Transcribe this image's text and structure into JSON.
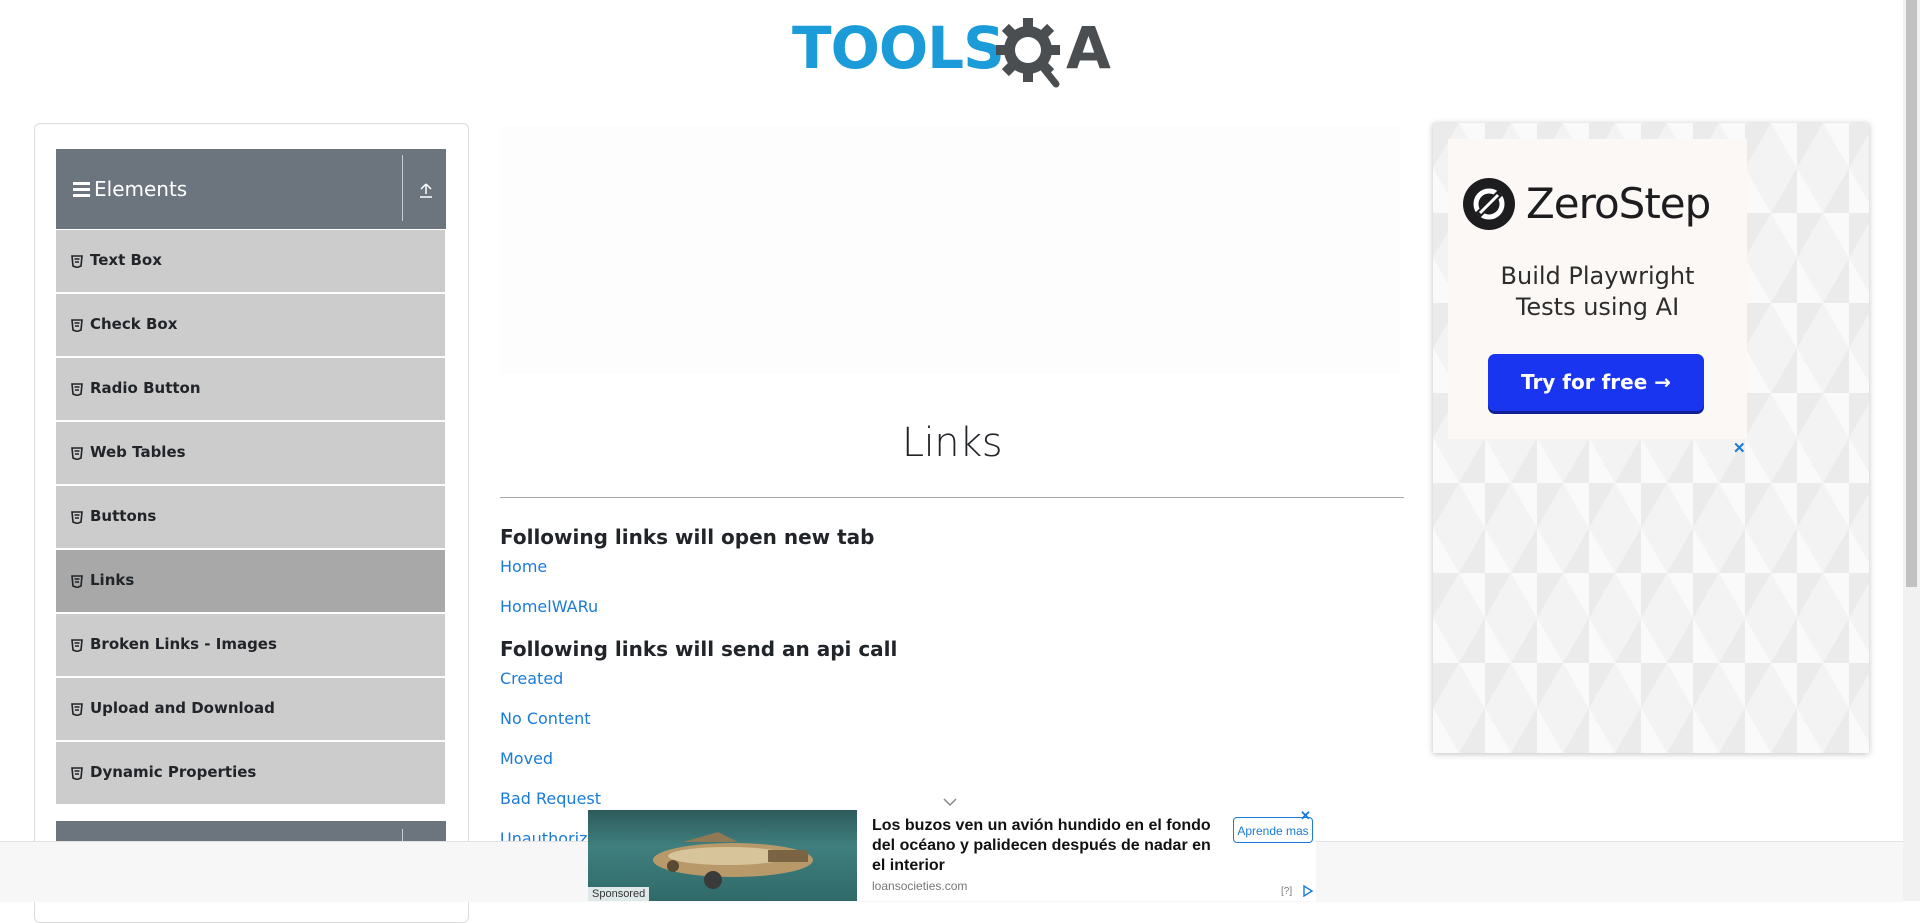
{
  "header": {
    "logo_text": "TOOLS",
    "logo_q": "Q",
    "logo_a": "A"
  },
  "sidebar": {
    "group_title": "Elements",
    "items": [
      {
        "label": "Text Box",
        "active": false
      },
      {
        "label": "Check Box",
        "active": false
      },
      {
        "label": "Radio Button",
        "active": false
      },
      {
        "label": "Web Tables",
        "active": false
      },
      {
        "label": "Buttons",
        "active": false
      },
      {
        "label": "Links",
        "active": true
      },
      {
        "label": "Broken Links - Images",
        "active": false
      },
      {
        "label": "Upload and Download",
        "active": false
      },
      {
        "label": "Dynamic Properties",
        "active": false
      }
    ]
  },
  "main": {
    "title": "Links",
    "section_new_tab": "Following links will open new tab",
    "new_tab_links": [
      "Home",
      "HomelWARu"
    ],
    "section_api": "Following links will send an api call",
    "api_links": [
      "Created",
      "No Content",
      "Moved",
      "Bad Request",
      "Unauthorized"
    ]
  },
  "ad_right": {
    "brand": "ZeroStep",
    "tagline_line1": "Build Playwright",
    "tagline_line2": "Tests using AI",
    "cta": "Try for free →",
    "close": "✕"
  },
  "ad_bottom": {
    "sponsored": "Sponsored",
    "headline": "Los buzos ven un avión hundido en el fondo del océano y palidecen después de nadar en el interior",
    "domain": "loansocieties.com",
    "cta": "Aprende mas",
    "info": "[?]",
    "close": "✕"
  },
  "colors": {
    "link": "#1b7bd7",
    "sidebar_header": "#6c757d",
    "sidebar_item": "#cccccc",
    "sidebar_item_active": "#a8a8a8",
    "logo_blue": "#1b9bd7",
    "cta_blue": "#1a35f0"
  }
}
